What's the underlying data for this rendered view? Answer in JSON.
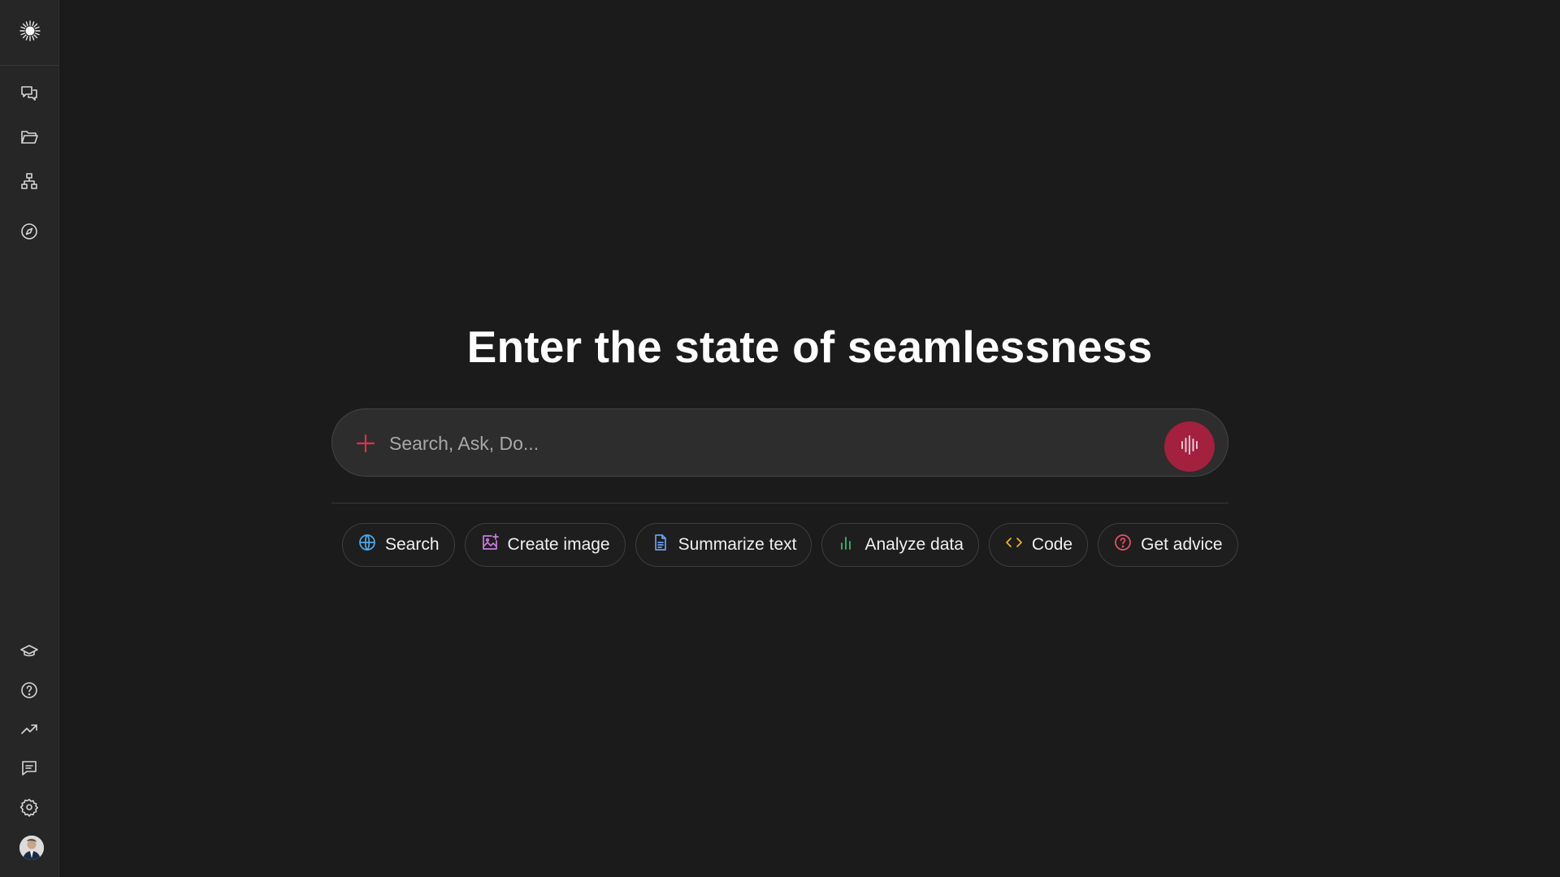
{
  "headline": "Enter the state of seamlessness",
  "search": {
    "placeholder": "Search, Ask, Do..."
  },
  "sidebar": {
    "top_items": [
      {
        "icon": "chats-icon"
      },
      {
        "icon": "folder-icon"
      },
      {
        "icon": "org-chart-icon"
      },
      {
        "icon": "compass-icon"
      }
    ],
    "bottom_items": [
      {
        "icon": "graduation-cap-icon"
      },
      {
        "icon": "help-icon"
      },
      {
        "icon": "trending-icon"
      },
      {
        "icon": "feedback-icon"
      },
      {
        "icon": "gear-icon"
      }
    ]
  },
  "chips": [
    {
      "label": "Search",
      "icon": "globe-icon",
      "color": "#4fa8e8"
    },
    {
      "label": "Create image",
      "icon": "image-edit-icon",
      "color": "#c77dde"
    },
    {
      "label": "Summarize text",
      "icon": "document-icon",
      "color": "#6a9ef0"
    },
    {
      "label": "Analyze data",
      "icon": "bar-chart-icon",
      "color": "#3ec46d"
    },
    {
      "label": "Code",
      "icon": "code-icon",
      "color": "#f0b429"
    },
    {
      "label": "Get advice",
      "icon": "question-circle-icon",
      "color": "#e8506a"
    }
  ],
  "colors": {
    "accent": "#a3203f",
    "plus": "#e0304e",
    "background": "#1b1b1b",
    "sidebar": "#262626"
  }
}
